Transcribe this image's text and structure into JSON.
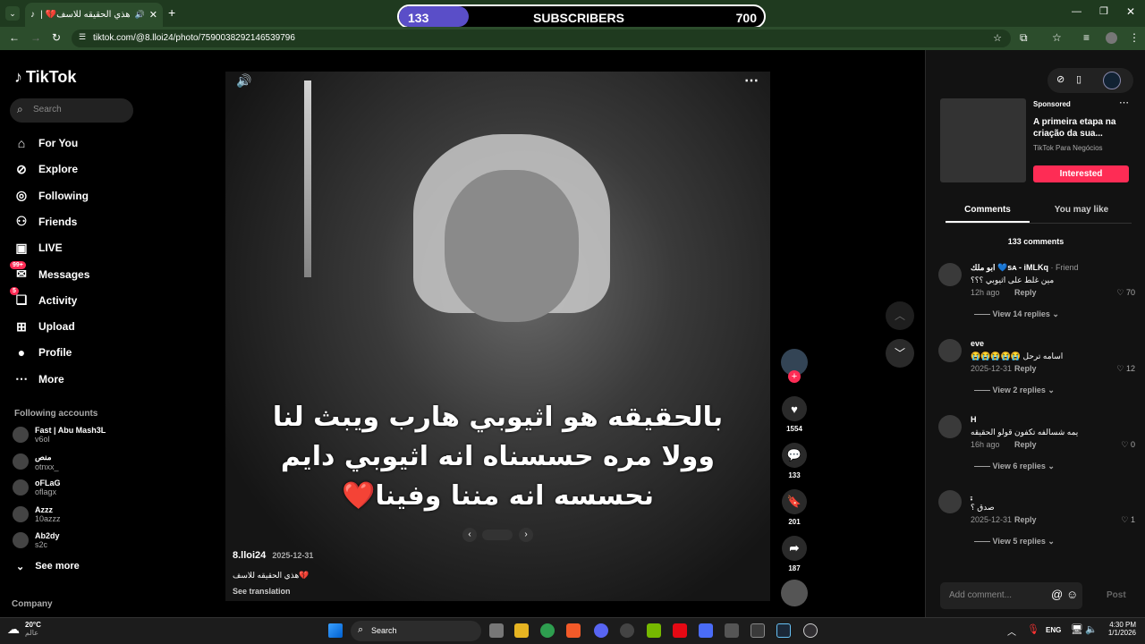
{
  "browser": {
    "tab_title": "هذي الحقيقه للاسف💔 | تيك",
    "url": "tiktok.com/@8.lloi24/photo/7590038292146539796"
  },
  "subscriber_bar": {
    "current": "133",
    "label": "SUBSCRIBERS",
    "goal": "700",
    "progress": 0.19
  },
  "sidebar": {
    "logo": "TikTok",
    "search_placeholder": "Search",
    "nav": [
      {
        "label": "For You",
        "icon": "home-icon"
      },
      {
        "label": "Explore",
        "icon": "compass-icon"
      },
      {
        "label": "Following",
        "icon": "following-icon"
      },
      {
        "label": "Friends",
        "icon": "friends-icon"
      },
      {
        "label": "LIVE",
        "icon": "live-icon"
      },
      {
        "label": "Messages",
        "icon": "messages-icon",
        "badge": "99+"
      },
      {
        "label": "Activity",
        "icon": "activity-icon",
        "badge": "5"
      },
      {
        "label": "Upload",
        "icon": "upload-icon"
      },
      {
        "label": "Profile",
        "icon": "profile-icon"
      },
      {
        "label": "More",
        "icon": "more-icon"
      }
    ],
    "following_title": "Following accounts",
    "accounts": [
      {
        "name": "Fast | Abu Mash3L",
        "handle": "v6ol"
      },
      {
        "name": "منص",
        "handle": "otnxx_"
      },
      {
        "name": "oFLaG",
        "handle": "oflagx"
      },
      {
        "name": "Azzz",
        "handle": "10azzz"
      },
      {
        "name": "Ab2dy",
        "handle": "s2c"
      }
    ],
    "see_more": "See more",
    "company": "Company"
  },
  "video": {
    "caption_lines": [
      "بالحقيقه هو اثيوبي هارب ويبث لنا",
      "وولا مره حسسناه انه اثيوبي دايم",
      "نحسسه انه مننا وفينا❤️"
    ],
    "author": "8.lloi24",
    "date": "2025-12-31",
    "description": "هذي الحقيقه للاسف💔",
    "see_translation": "See translation"
  },
  "actions": {
    "likes": "1554",
    "comments": "133",
    "saves": "201",
    "shares": "187"
  },
  "ad": {
    "sponsored": "Sponsored",
    "title": "A primeira etapa na criação da sua...",
    "advertiser": "TikTok Para Negócios",
    "button": "Interested"
  },
  "panel": {
    "tab_comments": "Comments",
    "tab_like": "You may like",
    "count": "133 comments",
    "comments": [
      {
        "name": "ابو ملك 💙sᴀ - iMLKq",
        "tag": " · Friend",
        "text": "مين غلط على اثيوبي ؟؟؟",
        "date": "12h ago",
        "likes": "70",
        "replies": "View 14 replies"
      },
      {
        "name": "eve",
        "tag": "",
        "text": "😭😭😭😭😭 اسامه ترحل",
        "date": "2025-12-31",
        "likes": "12",
        "replies": "View 2 replies"
      },
      {
        "name": "H",
        "tag": "",
        "text": "يمه شسالفه تكفون قولو الحقيقه",
        "date": "16h ago",
        "likes": "0",
        "replies": "View 6 replies"
      },
      {
        "name": "ـ۪ٜ",
        "tag": "",
        "text": "صدق ؟",
        "date": "2025-12-31",
        "likes": "1",
        "replies": "View 5 replies"
      }
    ],
    "reply_label": "Reply",
    "add_comment": "Add comment...",
    "post": "Post"
  },
  "taskbar": {
    "weather_temp": "20°C",
    "weather_place": "عالم",
    "search": "Search",
    "lang": "ENG",
    "time": "4:30 PM",
    "date": "1/1/2026"
  }
}
